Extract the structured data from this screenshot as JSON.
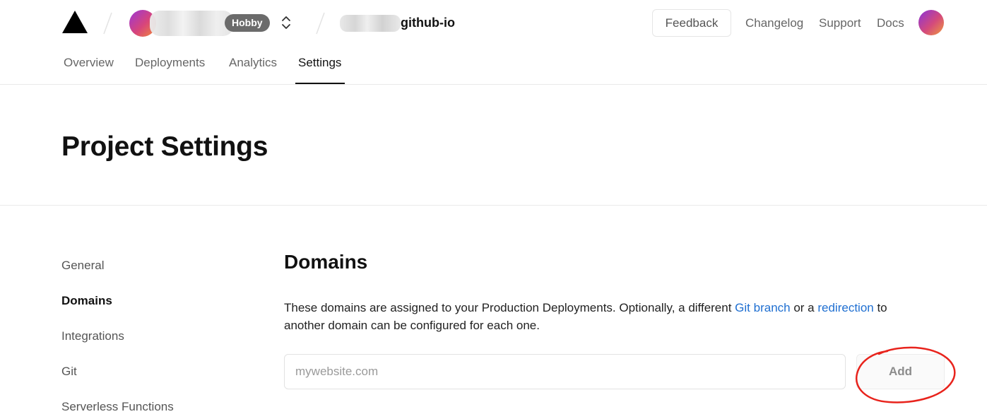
{
  "header": {
    "team_badge": "Hobby",
    "project_name": "github-io",
    "feedback_label": "Feedback",
    "links": [
      "Changelog",
      "Support",
      "Docs"
    ]
  },
  "tabs": [
    {
      "label": "Overview",
      "active": false
    },
    {
      "label": "Deployments",
      "active": false
    },
    {
      "label": "Analytics",
      "active": false
    },
    {
      "label": "Settings",
      "active": true
    }
  ],
  "page_title": "Project Settings",
  "sidebar": {
    "items": [
      {
        "label": "General",
        "active": false
      },
      {
        "label": "Domains",
        "active": true
      },
      {
        "label": "Integrations",
        "active": false
      },
      {
        "label": "Git",
        "active": false
      },
      {
        "label": "Serverless Functions",
        "active": false
      }
    ]
  },
  "domains": {
    "title": "Domains",
    "description_part1": "These domains are assigned to your Production Deployments. Optionally, a different ",
    "link_git_branch": "Git branch",
    "description_part2": " or a ",
    "link_redirection": "redirection",
    "description_part3": " to another domain can be configured for each one.",
    "input_placeholder": "mywebsite.com",
    "input_value": "",
    "add_label": "Add"
  },
  "colors": {
    "link": "#1f6fd1",
    "annotation": "#e8231c",
    "badge": "#6b6b6b"
  }
}
